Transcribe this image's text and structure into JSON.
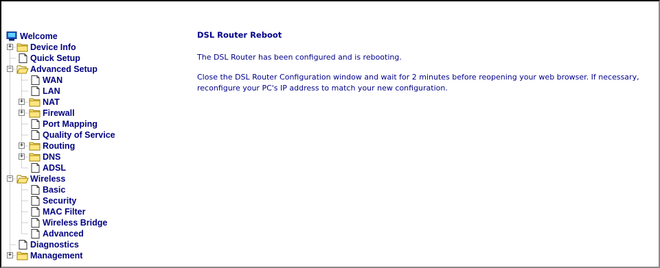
{
  "tree": {
    "welcome": "Welcome",
    "device_info": "Device Info",
    "quick_setup": "Quick Setup",
    "advanced_setup": "Advanced Setup",
    "wan": "WAN",
    "lan": "LAN",
    "nat": "NAT",
    "firewall": "Firewall",
    "port_mapping": "Port Mapping",
    "qos": "Quality of Service",
    "routing": "Routing",
    "dns": "DNS",
    "adsl": "ADSL",
    "wireless": "Wireless",
    "basic": "Basic",
    "security": "Security",
    "mac_filter": "MAC Filter",
    "wireless_bridge": "Wireless Bridge",
    "advanced": "Advanced",
    "diagnostics": "Diagnostics",
    "management": "Management"
  },
  "main": {
    "title": "DSL Router Reboot",
    "message1": "The DSL Router has been configured and is rebooting.",
    "message2": "Close the DSL Router Configuration window and wait for 2 minutes before reopening your web browser. If necessary, reconfigure your PC's IP address to match your new configuration."
  }
}
